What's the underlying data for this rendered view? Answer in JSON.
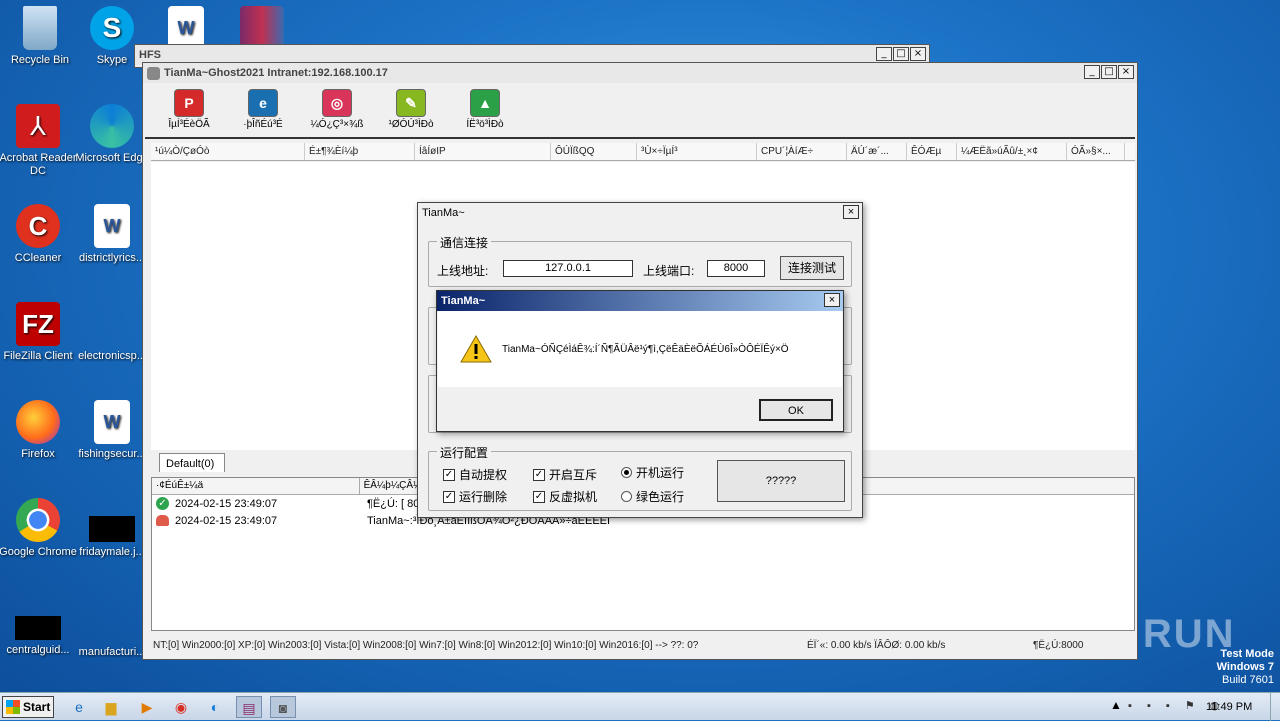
{
  "desktop_icons": [
    {
      "label": "Recycle Bin",
      "icon": "recycle-bin-icon"
    },
    {
      "label": "Skype",
      "icon": "skype-icon"
    },
    {
      "label": "Acrobat Reader DC",
      "icon": "acrobat-icon"
    },
    {
      "label": "Microsoft Edge",
      "icon": "edge-icon"
    },
    {
      "label": "CCleaner",
      "icon": "ccleaner-icon"
    },
    {
      "label": "districtlyrics...",
      "icon": "word-doc-icon"
    },
    {
      "label": "FileZilla Client",
      "icon": "filezilla-icon"
    },
    {
      "label": "electronicsp...",
      "icon": "doc-icon"
    },
    {
      "label": "Firefox",
      "icon": "firefox-icon"
    },
    {
      "label": "fishingsecur...",
      "icon": "word-doc-icon"
    },
    {
      "label": "Google Chrome",
      "icon": "chrome-icon"
    },
    {
      "label": "fridaymale.j...",
      "icon": "black-file-icon"
    },
    {
      "label": "centralguid...",
      "icon": "black-file-icon"
    },
    {
      "label": "manufacturi...",
      "icon": "doc-icon"
    }
  ],
  "hfs_window": {
    "title": "HFS"
  },
  "main_window": {
    "title": "TianMa~Ghost2021 Intranet:192.168.100.17",
    "toolbar": [
      {
        "label": "ÎµÍ³ÉèÖÃ",
        "glyph": "P",
        "color": "#d42a2a"
      },
      {
        "label": "·þÎñÉú³É",
        "glyph": "e",
        "color": "#1a6fb0"
      },
      {
        "label": "¼Ó¿Ç³×¾ß",
        "glyph": "◎",
        "color": "#d9345a"
      },
      {
        "label": "¹ØÓÚ³ÌÐò",
        "glyph": "✎",
        "color": "#88b820"
      },
      {
        "label": "ÍË³ö³ÌÐò",
        "glyph": "▲",
        "color": "#2ba046"
      }
    ],
    "columns": [
      "¹ú¼Ò/ÇøÓò",
      "É±¶¾Èí¼þ",
      "ÍâÍøIP",
      "ÔÚÏßQQ",
      "³Ù×÷ÏµÍ³",
      "CPU´¦ÀíÆ÷",
      "ÄÚ´æ´...",
      "ÊÓÆµ",
      "¼ÆËã»úÃû/±¸×¢",
      "ÓÃ»§×..."
    ],
    "tab": "Default(0)",
    "log_headers": [
      "·¢ÉúÊ±¼ä",
      "ÊÂ¼þ¼ÇÂ¼"
    ],
    "log_rows": [
      {
        "time": "2024-02-15 23:49:07",
        "text": "¶Ë¿Ú: [ 800",
        "status": "ok"
      },
      {
        "time": "2024-02-15 23:49:07",
        "text": "TianMa~:³ÌÐò¸Ä±äÉÏÏßÓÃ¾Ö²¿ÐÕÅÂÄ»÷äÊÉÉËÌ",
        "status": "warn"
      }
    ],
    "status_left": "NT:[0] Win2000:[0] XP:[0] Win2003:[0] Vista:[0] Win2008:[0] Win7:[0] Win8:[0] Win2012:[0] Win10:[0] Win2016:[0] --> ??: 0?",
    "status_mid": "ÉÏ´«: 0.00 kb/s  ÏÂÔØ: 0.00 kb/s",
    "status_right": "¶Ë¿Ú:8000"
  },
  "config_dialog": {
    "title": "TianMa~",
    "group_conn": "通信连接",
    "addr_label": "上线地址:",
    "addr_value": "127.0.0.1",
    "port_label": "上线端口:",
    "port_value": "8000",
    "test_button": "连接测试",
    "group_run": "运行配置",
    "opt1": "自动提权",
    "opt2": "开启互斥",
    "opt3": "开机运行",
    "opt4": "运行删除",
    "opt5": "反虚拟机",
    "opt6": "绿色运行",
    "gen_button": "?????"
  },
  "alert": {
    "title": "TianMa~",
    "message": "TianMa~ÓÑÇéÌáÊ¾:Í´Ñ¶ÃÜÂë¹ý¶ì,ÇëÊäÈëÕÁÉÙ6Î»ÒÔÉÏÊý×Ö",
    "ok": "OK"
  },
  "watermark": {
    "brand": "ANY RUN",
    "line1": "Test Mode",
    "line2": "Windows 7",
    "line3": "Build 7601"
  },
  "taskbar": {
    "start": "Start",
    "clock": "11:49 PM"
  }
}
